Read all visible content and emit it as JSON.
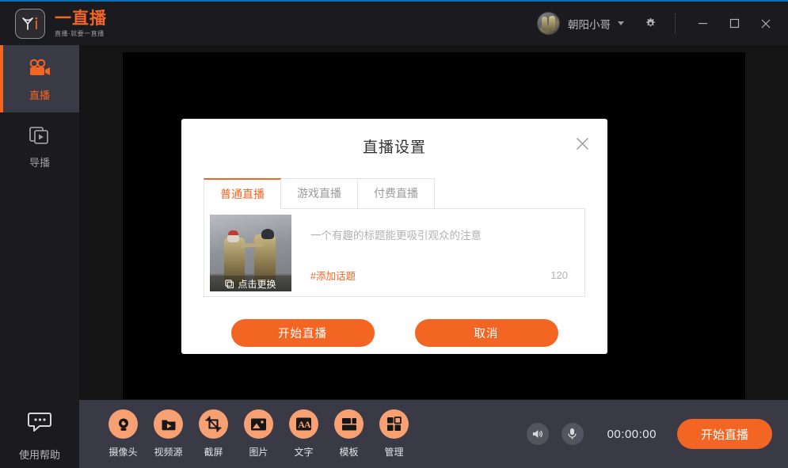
{
  "app": {
    "brand_title": "一直播",
    "brand_subtitle": "直播·就要一直播",
    "logo_icon": "yizhibo-logo-icon"
  },
  "topbar": {
    "username": "朝阳小哥",
    "caret_icon": "chevron-down-icon",
    "settings_icon": "gear-icon",
    "avatar_icon": "user-avatar",
    "window_controls": {
      "minimize_icon": "minimize-icon",
      "maximize_icon": "maximize-icon",
      "close_icon": "close-icon"
    }
  },
  "sidebar": {
    "items": [
      {
        "label": "直播",
        "icon": "video-camera-icon",
        "active": true
      },
      {
        "label": "导播",
        "icon": "layers-play-icon",
        "active": false
      }
    ],
    "help": {
      "label": "使用帮助",
      "icon": "chat-bubble-icon"
    }
  },
  "bottom_toolbar": {
    "tools": [
      {
        "label": "摄像头",
        "icon": "webcam-icon"
      },
      {
        "label": "视频源",
        "icon": "video-folder-icon"
      },
      {
        "label": "截屏",
        "icon": "crop-screenshot-icon"
      },
      {
        "label": "图片",
        "icon": "image-icon"
      },
      {
        "label": "文字",
        "icon": "text-aa-icon"
      },
      {
        "label": "模板",
        "icon": "template-layout-icon"
      },
      {
        "label": "管理",
        "icon": "manage-grid-icon"
      }
    ],
    "speaker_icon": "speaker-volume-icon",
    "mic_icon": "microphone-icon",
    "timer": "00:00:00",
    "go_live_label": "开始直播"
  },
  "modal": {
    "title": "直播设置",
    "close_icon": "close-icon",
    "tabs": [
      {
        "label": "普通直播",
        "active": true
      },
      {
        "label": "游戏直播",
        "active": false
      },
      {
        "label": "付费直播",
        "active": false
      }
    ],
    "thumbnail": {
      "overlay_label": "点击更换",
      "overlay_icon": "image-swap-icon"
    },
    "title_input": {
      "value": "",
      "placeholder": "一个有趣的标题能更吸引观众的注意"
    },
    "topic_link": "#添加话题",
    "char_counter": "120",
    "primary_button": "开始直播",
    "secondary_button": "取消"
  },
  "colors": {
    "accent": "#f26522",
    "topbar_bg": "#1b1b1f",
    "panel_bg": "#3a3a47",
    "body_bg": "#141414",
    "window_border": "#0c6fb5"
  }
}
